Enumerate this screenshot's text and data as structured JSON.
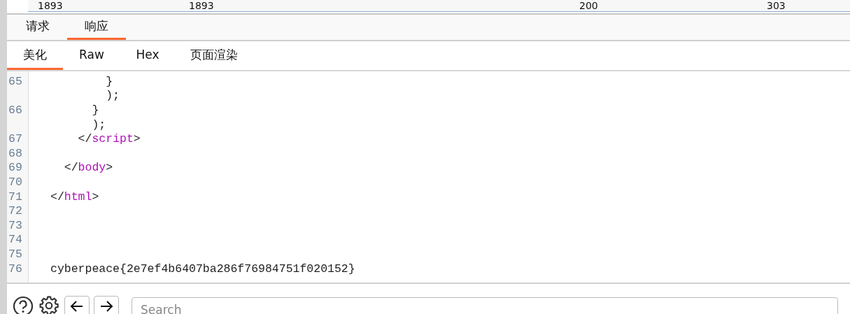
{
  "top_row": {
    "cells": [
      "1893",
      "1893",
      "200",
      "303"
    ]
  },
  "tabs": [
    {
      "label": "请求",
      "selected": false
    },
    {
      "label": "响应",
      "selected": true
    }
  ],
  "view_tabs": [
    {
      "label": "美化",
      "selected": true
    },
    {
      "label": "Raw",
      "selected": false
    },
    {
      "label": "Hex",
      "selected": false
    },
    {
      "label": "页面渲染",
      "selected": false
    }
  ],
  "code_lines": [
    {
      "number": "65",
      "segments": [
        {
          "kind": "text",
          "text": "        }"
        }
      ]
    },
    {
      "segments": [
        {
          "kind": "text",
          "text": "        );"
        }
      ]
    },
    {
      "number": "66",
      "segments": [
        {
          "kind": "text",
          "text": "      }"
        }
      ]
    },
    {
      "segments": [
        {
          "kind": "text",
          "text": "      );"
        }
      ]
    },
    {
      "number": "67",
      "segments": [
        {
          "kind": "text",
          "text": "    </"
        },
        {
          "kind": "tag",
          "text": "script"
        },
        {
          "kind": "text",
          "text": ">"
        }
      ]
    },
    {
      "number": "68"
    },
    {
      "number": "69",
      "segments": [
        {
          "kind": "text",
          "text": "  </"
        },
        {
          "kind": "tag",
          "text": "body"
        },
        {
          "kind": "text",
          "text": ">"
        }
      ]
    },
    {
      "number": "70"
    },
    {
      "number": "71",
      "segments": [
        {
          "kind": "text",
          "text": "</"
        },
        {
          "kind": "tag",
          "text": "html"
        },
        {
          "kind": "text",
          "text": ">"
        }
      ]
    },
    {
      "number": "72"
    },
    {
      "number": "73"
    },
    {
      "number": "74"
    },
    {
      "number": "75"
    },
    {
      "number": "76",
      "segments": [
        {
          "kind": "text",
          "text": "cyberpeace{2e7ef4b6407ba286f76984751f020152}"
        }
      ]
    }
  ],
  "search": {
    "placeholder": "Search"
  }
}
